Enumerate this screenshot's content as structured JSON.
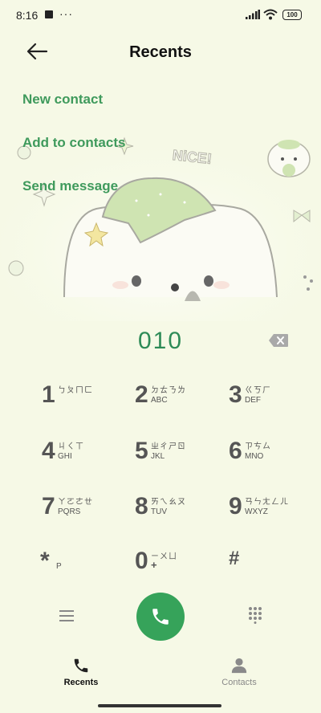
{
  "status": {
    "time": "8:16",
    "battery": "100"
  },
  "header": {
    "title": "Recents"
  },
  "menu": [
    {
      "label": "New contact"
    },
    {
      "label": "Add to contacts"
    },
    {
      "label": "Send message"
    }
  ],
  "art": {
    "nice_text": "NiCE!"
  },
  "dial": {
    "number": "010"
  },
  "keys": [
    {
      "digit": "1",
      "zhuyin": "ㄅㄆㄇㄈ",
      "letters": ""
    },
    {
      "digit": "2",
      "zhuyin": "ㄉㄊㄋㄌ",
      "letters": "ABC"
    },
    {
      "digit": "3",
      "zhuyin": "ㄍㄎㄏ",
      "letters": "DEF"
    },
    {
      "digit": "4",
      "zhuyin": "ㄐㄑㄒ",
      "letters": "GHI"
    },
    {
      "digit": "5",
      "zhuyin": "ㄓㄔㄕㄖ",
      "letters": "JKL"
    },
    {
      "digit": "6",
      "zhuyin": "ㄗㄘㄙ",
      "letters": "MNO"
    },
    {
      "digit": "7",
      "zhuyin": "ㄚㄛㄜㄝ",
      "letters": "PQRS"
    },
    {
      "digit": "8",
      "zhuyin": "ㄞㄟㄠㄡ",
      "letters": "TUV"
    },
    {
      "digit": "9",
      "zhuyin": "ㄢㄣㄤㄥㄦ",
      "letters": "WXYZ"
    },
    {
      "digit": "*",
      "zhuyin": "",
      "letters": "P"
    },
    {
      "digit": "0",
      "zhuyin": "ㄧㄨㄩ",
      "letters": "+"
    },
    {
      "digit": "#",
      "zhuyin": "",
      "letters": ""
    }
  ],
  "nav": {
    "recents": "Recents",
    "contacts": "Contacts"
  },
  "colors": {
    "accent": "#36a35a",
    "accent_text": "#3f9a5c",
    "background": "#f6f9e6"
  },
  "icons": {
    "back": "arrow-left-icon",
    "backspace": "backspace-icon",
    "menu": "hamburger-icon",
    "dialpad": "dialpad-icon",
    "call": "phone-icon",
    "recents": "phone-icon",
    "contacts": "person-icon"
  }
}
